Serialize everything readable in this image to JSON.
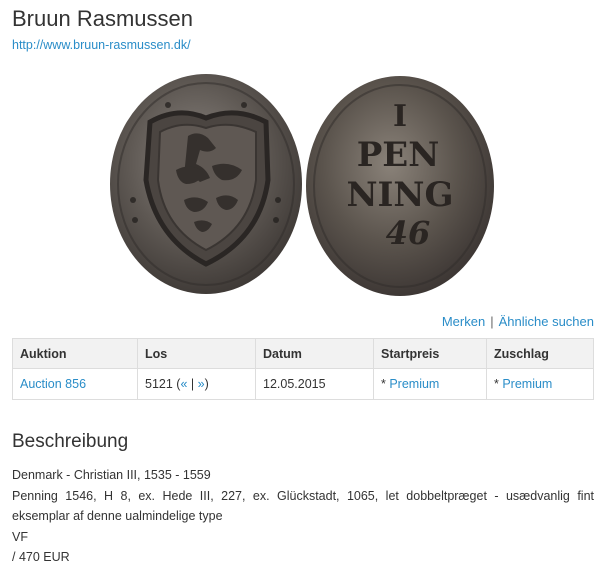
{
  "header": {
    "title": "Bruun Rasmussen",
    "url": "http://www.bruun-rasmussen.dk/"
  },
  "coin_image": {
    "reverse_text": [
      "I",
      "PEN",
      "NING",
      "46"
    ]
  },
  "actions": {
    "merken": "Merken",
    "separator": "|",
    "aehnliche": "Ähnliche suchen"
  },
  "table": {
    "headers": [
      "Auktion",
      "Los",
      "Datum",
      "Startpreis",
      "Zuschlag"
    ],
    "row": {
      "auction": "Auction 856",
      "lot_number": "5121 (",
      "prev": "«",
      "pipe": "|",
      "next": "»",
      "lot_close": ")",
      "date": "12.05.2015",
      "start_star": "* ",
      "start_premium": "Premium",
      "hammer_star": "* ",
      "hammer_premium": "Premium"
    }
  },
  "description": {
    "heading": "Beschreibung",
    "lines": [
      "Denmark - Christian III, 1535 - 1559",
      "Penning 1546, H 8, ex. Hede III, 227, ex. Glückstadt, 1065, let dobbeltpræget - usædvanlig fint eksemplar af denne ualmindelige type",
      "VF",
      "/ 470 EUR"
    ]
  },
  "colors": {
    "link": "#2a8dc8",
    "text": "#333333",
    "header_bg": "#f2f2f2",
    "border": "#dddddd"
  }
}
